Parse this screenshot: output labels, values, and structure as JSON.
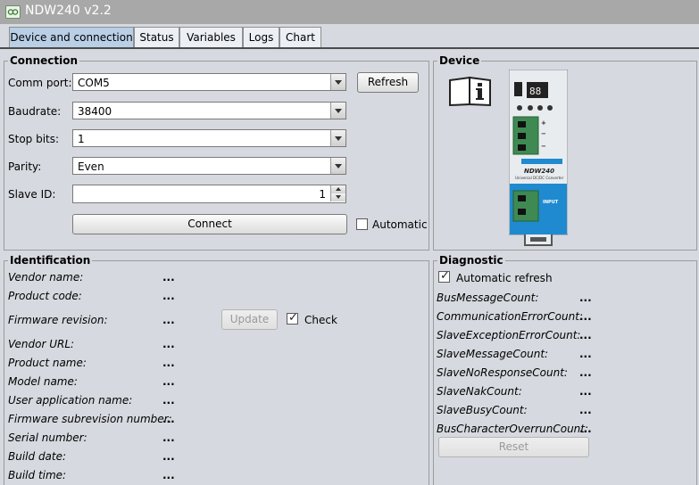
{
  "window": {
    "title": "NDW240 v2.2"
  },
  "tabs": [
    {
      "label": "Device and connection",
      "active": true
    },
    {
      "label": "Status"
    },
    {
      "label": "Variables"
    },
    {
      "label": "Logs"
    },
    {
      "label": "Chart"
    }
  ],
  "connection": {
    "title": "Connection",
    "comm_port": {
      "label": "Comm port:",
      "value": "COM5"
    },
    "refresh_label": "Refresh",
    "baudrate": {
      "label": "Baudrate:",
      "value": "38400"
    },
    "stop_bits": {
      "label": "Stop bits:",
      "value": "1"
    },
    "parity": {
      "label": "Parity:",
      "value": "Even"
    },
    "slave_id": {
      "label": "Slave ID:",
      "value": "1"
    },
    "connect_label": "Connect",
    "automatic_label": "Automatic",
    "automatic_checked": false
  },
  "device": {
    "title": "Device",
    "product_text": {
      "brand": "NEXTYS",
      "model": "NDW240",
      "subtitle": "Universal DC/DC Converter"
    }
  },
  "identification": {
    "title": "Identification",
    "fields": [
      {
        "label": "Vendor name:",
        "value": "..."
      },
      {
        "label": "Product code:",
        "value": "..."
      },
      {
        "label": "Firmware revision:",
        "value": "..."
      },
      {
        "label": "Vendor URL:",
        "value": "..."
      },
      {
        "label": "Product name:",
        "value": "..."
      },
      {
        "label": "Model name:",
        "value": "..."
      },
      {
        "label": "User application name:",
        "value": "..."
      },
      {
        "label": "Firmware subrevision number:",
        "value": "..."
      },
      {
        "label": "Serial number:",
        "value": "..."
      },
      {
        "label": "Build date:",
        "value": "..."
      },
      {
        "label": "Build time:",
        "value": "..."
      }
    ],
    "update_label": "Update",
    "check_label": "Check",
    "check_checked": true
  },
  "diagnostic": {
    "title": "Diagnostic",
    "auto_refresh_label": "Automatic refresh",
    "auto_refresh_checked": true,
    "counters": [
      {
        "label": "BusMessageCount:",
        "value": "..."
      },
      {
        "label": "CommunicationErrorCount:",
        "value": "..."
      },
      {
        "label": "SlaveExceptionErrorCount:",
        "value": "..."
      },
      {
        "label": "SlaveMessageCount:",
        "value": "..."
      },
      {
        "label": "SlaveNoResponseCount:",
        "value": "..."
      },
      {
        "label": "SlaveNakCount:",
        "value": "..."
      },
      {
        "label": "SlaveBusyCount:",
        "value": "..."
      },
      {
        "label": "BusCharacterOverrunCount:",
        "value": "..."
      }
    ],
    "reset_label": "Reset"
  }
}
